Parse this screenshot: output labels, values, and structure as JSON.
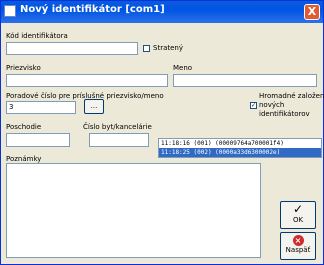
{
  "window": {
    "title": "Nový identifikátor [com1]",
    "close_label": "X"
  },
  "form": {
    "kod_label": "Kód identifikátora",
    "kod_value": "",
    "straceny_label": "Stratený",
    "priezvisko_label": "Priezvisko",
    "priezvisko_value": "",
    "meno_label": "Meno",
    "meno_value": "",
    "poradove_label": "Poradové číslo pre príslušné priezvisko/meno",
    "poradove_value": "3",
    "browse_label": "...",
    "hromadne_label_line1": "Hromadné založenie",
    "hromadne_label_line2": "nových",
    "hromadne_label_line3": "identifikátorov",
    "hromadne_checked": true,
    "poschodie_label": "Poschodie",
    "poschodie_value": "",
    "cislo_label": "Číslo byt/kancelárie",
    "cislo_value": "",
    "poznamky_label": "Poznámky",
    "poznamky_value": ""
  },
  "list": {
    "items": [
      "11:18:16 (001) (00009764a700001f4)",
      "11:18:25 (002) (0000a33d6300002e)"
    ],
    "selected_index": 1
  },
  "buttons": {
    "ok_label": "OK",
    "ok_icon": "✓",
    "cancel_label": "Naspäť",
    "cancel_icon": "⨯"
  },
  "colors": {
    "titlebar": "#0054e3",
    "selection": "#316ac5",
    "cancel_icon": "#d22b2b"
  }
}
